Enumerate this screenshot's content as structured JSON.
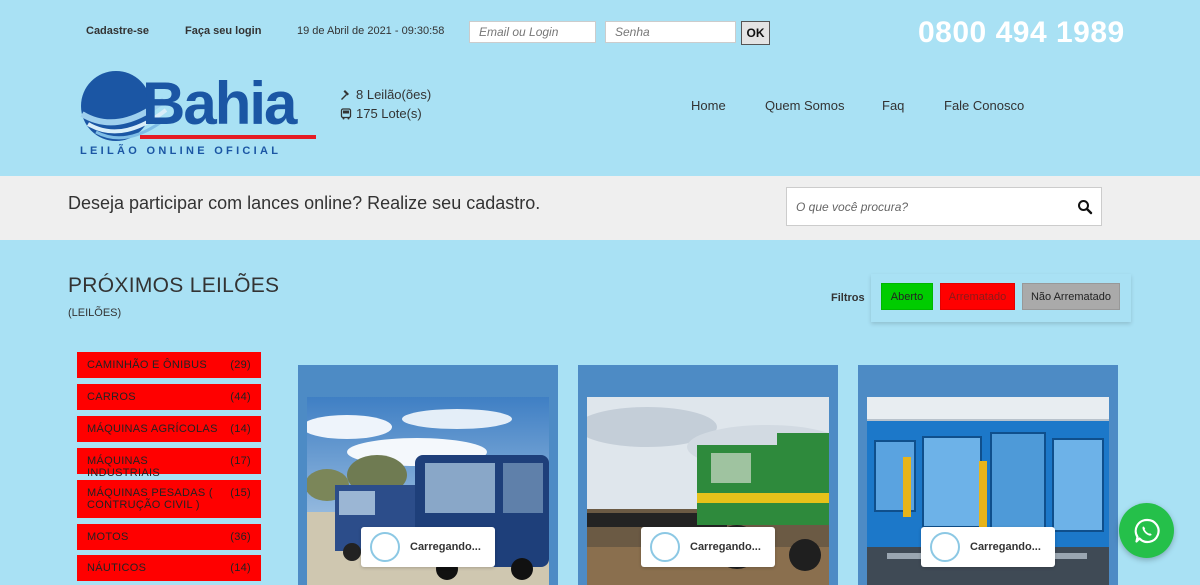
{
  "topbar": {
    "register": "Cadastre-se",
    "login": "Faça seu login",
    "datetime": "19 de Abril de 2021 - 09:30:58",
    "email_placeholder": "Email ou Login",
    "password_placeholder": "Senha",
    "ok_label": "OK",
    "phone": "0800 494 1989"
  },
  "logo": {
    "name": "Bahia",
    "tagline": "LEILÃO ONLINE OFICIAL",
    "brand_color": "#1b56a4",
    "accent_color": "#e51b24"
  },
  "stats": {
    "auctions": "8 Leilão(ões)",
    "lots": "175 Lote(s)"
  },
  "nav": [
    "Home",
    "Quem Somos",
    "Faq",
    "Fale Conosco"
  ],
  "banner": {
    "text": "Deseja participar com lances online? Realize seu cadastro.",
    "search_placeholder": "O que você procura?"
  },
  "section": {
    "title": "PRÓXIMOS LEILÕES",
    "subtitle": "(LEILÕES)"
  },
  "filters": {
    "label": "Filtros",
    "buttons": [
      {
        "label": "Aberto",
        "color": "#00cc00"
      },
      {
        "label": "Arrematado",
        "color": "#ff0000"
      },
      {
        "label": "Não Arrematado",
        "color": "#aaaaaa"
      }
    ]
  },
  "categories": [
    {
      "label": "CAMINHÃO E ÔNIBUS",
      "count": "(29)"
    },
    {
      "label": "CARROS",
      "count": "(44)"
    },
    {
      "label": "MÁQUINAS AGRÍCOLAS",
      "count": "(14)"
    },
    {
      "label": "MÁQUINAS INDUSTRIAIS",
      "count": "(17)"
    },
    {
      "label": "MÁQUINAS PESADAS ( CONTRUÇÃO CIVIL )",
      "count": "(15)"
    },
    {
      "label": "MOTOS",
      "count": "(36)"
    },
    {
      "label": "NÁUTICOS",
      "count": "(14)"
    }
  ],
  "cards": [
    {
      "loading": "Carregando..."
    },
    {
      "loading": "Carregando..."
    },
    {
      "loading": "Carregando..."
    }
  ],
  "colors": {
    "background": "#a9e1f4",
    "card": "#4d8bc5",
    "whatsapp": "#25c04a"
  }
}
